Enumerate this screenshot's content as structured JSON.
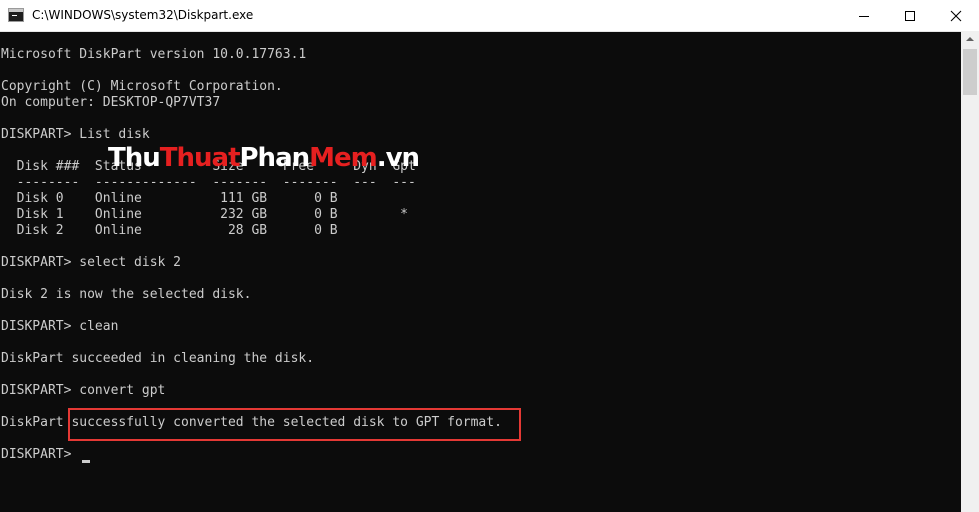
{
  "window": {
    "title": "C:\\WINDOWS\\system32\\Diskpart.exe",
    "controls": [
      "minimize-icon",
      "maximize-icon",
      "close-icon"
    ]
  },
  "console": {
    "lines": [
      "Microsoft DiskPart version 10.0.17763.1",
      "",
      "Copyright (C) Microsoft Corporation.",
      "On computer: DESKTOP-QP7VT37",
      "",
      "DISKPART> List disk",
      "",
      "  Disk ###  Status         Size     Free     Dyn  Gpt",
      "  --------  -------------  -------  -------  ---  ---",
      "  Disk 0    Online          111 GB      0 B",
      "  Disk 1    Online          232 GB      0 B        *",
      "  Disk 2    Online           28 GB      0 B",
      "",
      "DISKPART> select disk 2",
      "",
      "Disk 2 is now the selected disk.",
      "",
      "DISKPART> clean",
      "",
      "DiskPart succeeded in cleaning the disk.",
      "",
      "DISKPART> convert gpt",
      "",
      "DiskPart successfully converted the selected disk to GPT format.",
      "",
      "DISKPART> "
    ],
    "text_color": "#cccccc",
    "background": "#0c0c0c"
  },
  "watermark": {
    "part1": "Thu",
    "part2": "Thuat",
    "part3": "Phan",
    "part4": "Mem",
    "part5": ".vn"
  },
  "highlight_color": "#e53935"
}
